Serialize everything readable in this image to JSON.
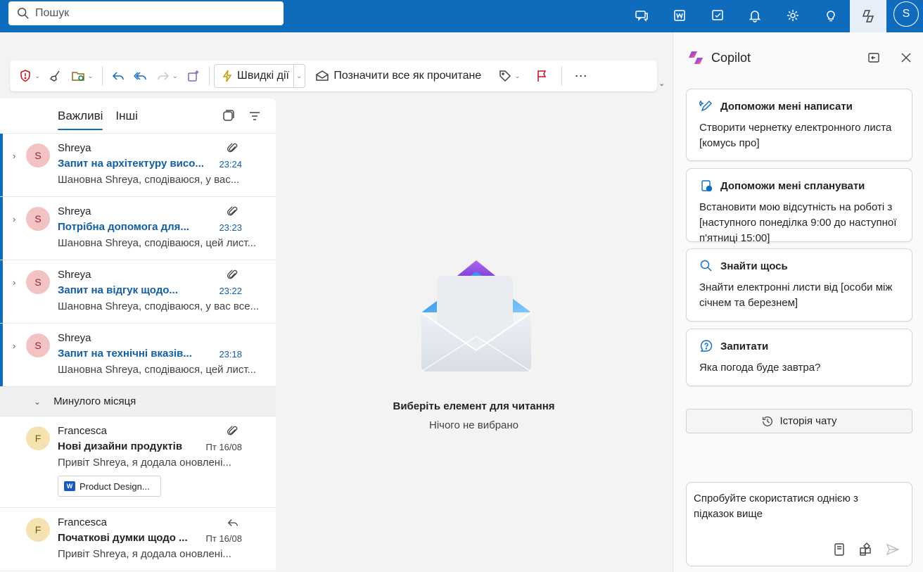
{
  "search": {
    "placeholder": "Пошук"
  },
  "header": {
    "avatar_initial": "S"
  },
  "toolbar": {
    "quick_actions": "Швидкі дії",
    "mark_all_read": "Позначити все як прочитане",
    "more": "⋯"
  },
  "list": {
    "tabs": [
      "Важливі",
      "Інші"
    ],
    "unread": [
      {
        "initial": "S",
        "sender": "Shreya",
        "subject": "Запит на архітектуру висо...",
        "time": "23:24",
        "preview": "Шановна Shreya, сподіваюся, у вас..."
      },
      {
        "initial": "S",
        "sender": "Shreya",
        "subject": "Потрібна допомога для...",
        "time": "23:23",
        "preview": "Шановна Shreya, сподіваюся, цей лист..."
      },
      {
        "initial": "S",
        "sender": "Shreya",
        "subject": "Запит на відгук щодо...",
        "time": "23:22",
        "preview": "Шановна Shreya, сподіваюся, у вас все..."
      },
      {
        "initial": "S",
        "sender": "Shreya",
        "subject": "Запит на технічні вказів...",
        "time": "23:18",
        "preview": "Шановна Shreya, сподіваюся, цей лист..."
      }
    ],
    "group_header": "Минулого місяця",
    "older": [
      {
        "initial": "F",
        "sender": "Francesca",
        "subject": "Нові дизайни продуктів",
        "time": "Пт 16/08",
        "preview": "Привіт Shreya, я додала оновлені...",
        "attachment": "Product Design..."
      },
      {
        "initial": "F",
        "sender": "Francesca",
        "subject": "Початкові думки щодо ...",
        "time": "Пт 16/08",
        "preview": "Привіт Shreya, я додала оновлені..."
      }
    ]
  },
  "reading": {
    "title": "Виберіть елемент для читання",
    "subtitle": "Нічого не вибрано"
  },
  "copilot": {
    "title": "Copilot",
    "cards": [
      {
        "title": "Допоможи мені написати",
        "body": "Створити чернетку електронного листа [комусь про]"
      },
      {
        "title": "Допоможи мені спланувати",
        "body": "Встановити мою відсутність на роботі з [наступного понеділка 9:00 до наступної п'ятниці 15:00]"
      },
      {
        "title": "Знайти щось",
        "body": "Знайти електронні листи від [особи між січнем та березнем]"
      },
      {
        "title": "Запитати",
        "body": "Яка погода буде завтра?"
      }
    ],
    "history": "Історія чату",
    "composer_placeholder": "Спробуйте скористатися однією з підказок вище"
  },
  "colors": {
    "brand": "#0f6cbd",
    "unread_subject": "#115ea3"
  }
}
